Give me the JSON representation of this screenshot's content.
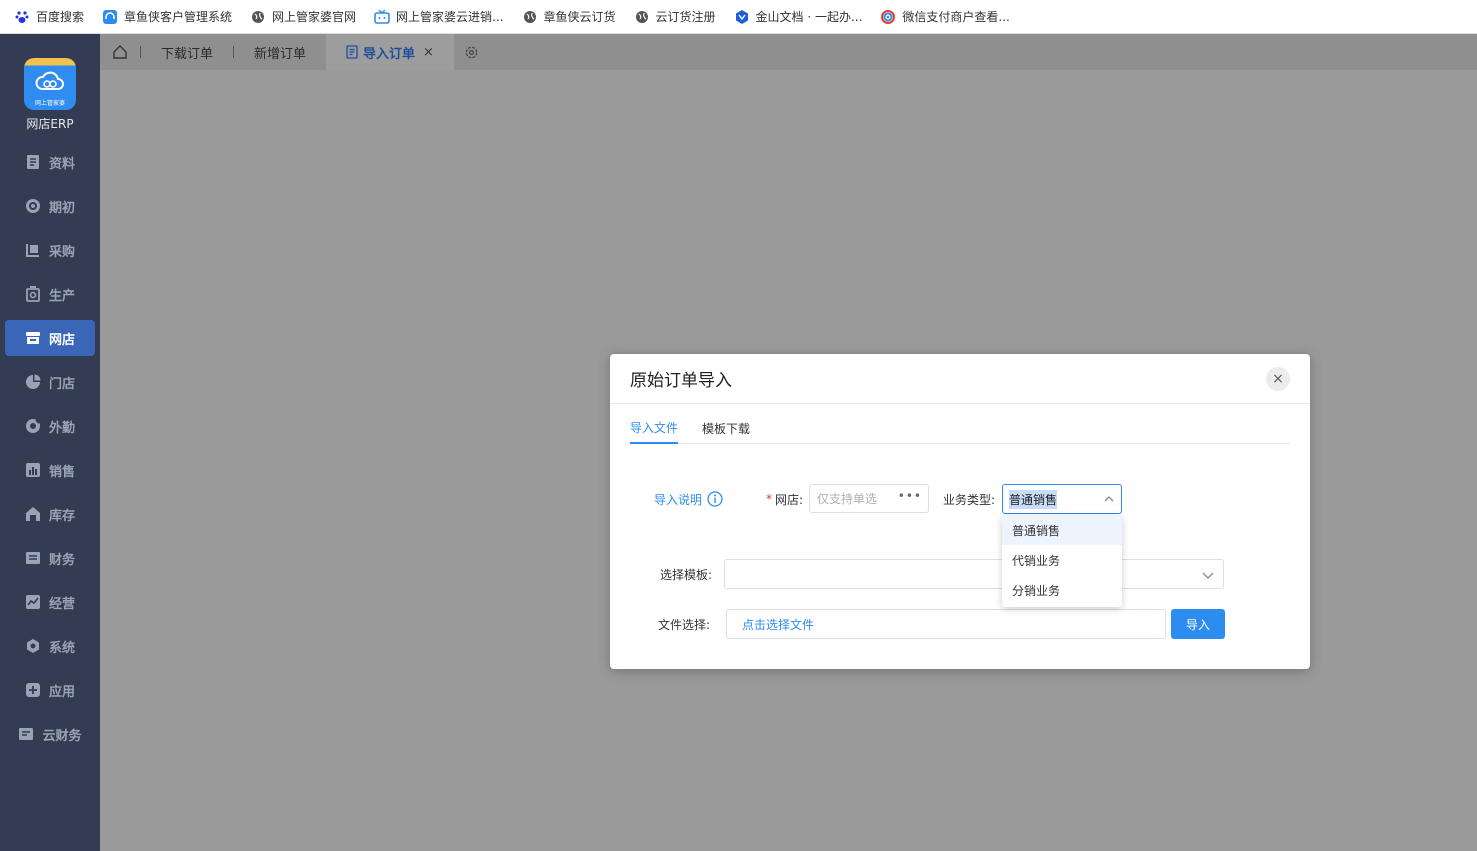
{
  "bookmarks": [
    {
      "label": "百度搜索",
      "icon": "baidu-paw-icon"
    },
    {
      "label": "章鱼侠客户管理系统",
      "icon": "headset-icon"
    },
    {
      "label": "网上管家婆官网",
      "icon": "globe-icon"
    },
    {
      "label": "网上管家婆云进销...",
      "icon": "tv-icon"
    },
    {
      "label": "章鱼侠云订货",
      "icon": "globe-icon"
    },
    {
      "label": "云订货注册",
      "icon": "globe-icon"
    },
    {
      "label": "金山文档 · 一起办...",
      "icon": "kdocs-icon"
    },
    {
      "label": "微信支付商户查看...",
      "icon": "colorful-circle-icon"
    }
  ],
  "app": {
    "logo_caption": "网上管家婆",
    "name": "网店ERP"
  },
  "sidebar": {
    "items": [
      {
        "label": "资料",
        "icon": "document-icon"
      },
      {
        "label": "期初",
        "icon": "target-icon"
      },
      {
        "label": "采购",
        "icon": "cart-icon"
      },
      {
        "label": "生产",
        "icon": "factory-icon"
      },
      {
        "label": "网店",
        "icon": "store-icon",
        "active": true
      },
      {
        "label": "门店",
        "icon": "pie-icon"
      },
      {
        "label": "外勤",
        "icon": "compass-icon"
      },
      {
        "label": "销售",
        "icon": "bar-chart-icon"
      },
      {
        "label": "库存",
        "icon": "warehouse-icon"
      },
      {
        "label": "财务",
        "icon": "ledger-icon"
      },
      {
        "label": "经营",
        "icon": "trend-icon"
      },
      {
        "label": "系统",
        "icon": "hexagon-gear-icon"
      },
      {
        "label": "应用",
        "icon": "plus-square-icon"
      },
      {
        "label": "云财务",
        "icon": "cloud-ledger-icon"
      }
    ]
  },
  "tabs": {
    "items": [
      {
        "label": "下载订单"
      },
      {
        "label": "新增订单"
      },
      {
        "label": "导入订单",
        "active": true
      }
    ],
    "close_glyph": "×"
  },
  "modal": {
    "title": "原始订单导入",
    "close_glyph": "×",
    "tabs": [
      "导入文件",
      "模板下载"
    ],
    "help_label": "导入说明",
    "shop_label": "网店:",
    "required_mark": "*",
    "shop_placeholder": "仅支持单选",
    "shop_more": "•••",
    "type_label": "业务类型:",
    "type_value": "普通销售",
    "type_options": [
      "普通销售",
      "代销业务",
      "分销业务"
    ],
    "template_label": "选择模板:",
    "template_value": "",
    "file_label": "文件选择:",
    "file_button": "点击选择文件",
    "import_button": "导入"
  },
  "colors": {
    "sidebar_bg": "#333c52",
    "active_nav": "#3a66b8",
    "primary": "#2d8cf0",
    "overlay": "#9a9a9a"
  }
}
